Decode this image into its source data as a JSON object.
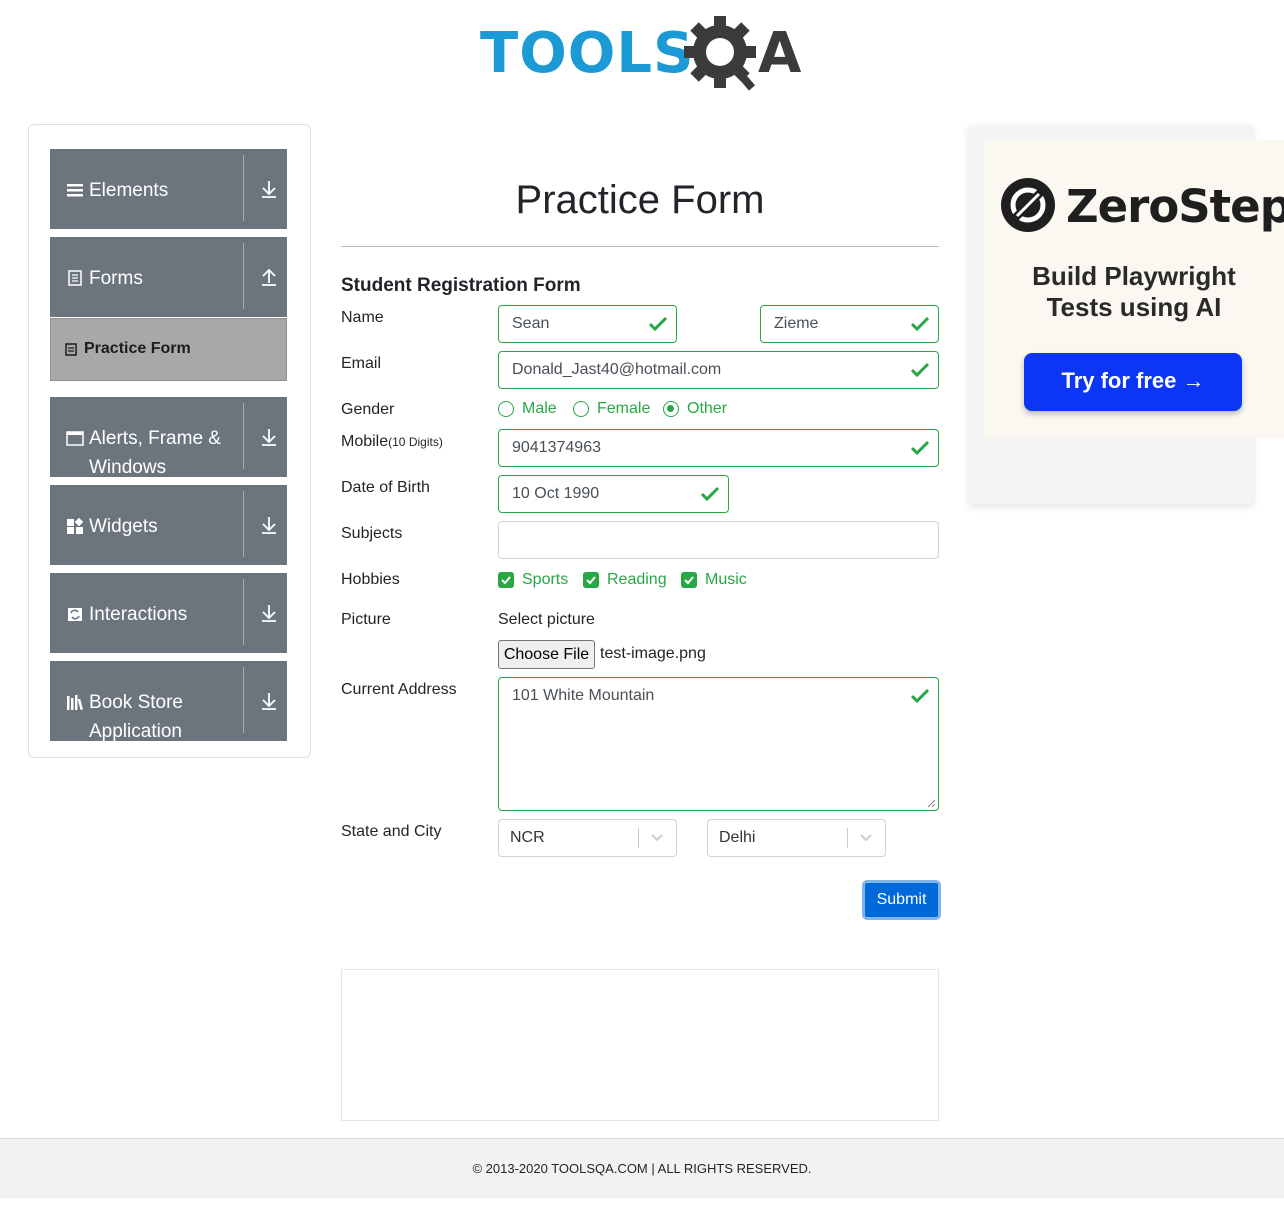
{
  "header": {
    "logo_left": "TOOLS",
    "logo_right": "A"
  },
  "sidebar": {
    "groups": [
      {
        "label": "Elements",
        "icon": "list-icon",
        "arrow": "down"
      },
      {
        "label": "Forms",
        "icon": "document-icon",
        "arrow": "up"
      },
      {
        "label": "Alerts, Frame & Windows",
        "icon": "window-icon",
        "arrow": "down"
      },
      {
        "label": "Widgets",
        "icon": "widgets-icon",
        "arrow": "down"
      },
      {
        "label": "Interactions",
        "icon": "interactions-icon",
        "arrow": "down"
      },
      {
        "label": "Book Store Application",
        "icon": "books-icon",
        "arrow": "down"
      }
    ],
    "active_item": "Practice Form"
  },
  "form": {
    "page_title": "Practice Form",
    "title": "Student Registration Form",
    "labels": {
      "name": "Name",
      "email": "Email",
      "gender": "Gender",
      "mobile": "Mobile",
      "mobile_hint": "(10 Digits)",
      "dob": "Date of Birth",
      "subjects": "Subjects",
      "hobbies": "Hobbies",
      "picture": "Picture",
      "address": "Current Address",
      "state_city": "State and City"
    },
    "values": {
      "first_name": "Sean",
      "last_name": "Zieme",
      "email": "Donald_Jast40@hotmail.com",
      "mobile": "9041374963",
      "dob": "10 Oct 1990",
      "subjects": "",
      "address": "101 White Mountain",
      "state": "NCR",
      "city": "Delhi"
    },
    "gender_options": [
      "Male",
      "Female",
      "Other"
    ],
    "gender_selected": "Other",
    "hobbies": [
      "Sports",
      "Reading",
      "Music"
    ],
    "hobbies_checked": [
      "Sports",
      "Reading",
      "Music"
    ],
    "picture_label": "Select picture",
    "choose_file": "Choose File",
    "file_name": "test-image.png",
    "submit": "Submit"
  },
  "ad": {
    "brand": "ZeroStep",
    "tagline_line1": "Build Playwright",
    "tagline_line2": "Tests using AI",
    "button": "Try for free →"
  },
  "footer": {
    "text": "© 2013-2020 TOOLSQA.COM | ALL RIGHTS RESERVED."
  },
  "colors": {
    "valid": "#28a745",
    "sidebar_group": "#6c757d",
    "active_item": "#a8a8a8",
    "submit": "#0069d9",
    "ad_button": "#0b36f5",
    "logo_blue": "#1c9ad6"
  }
}
